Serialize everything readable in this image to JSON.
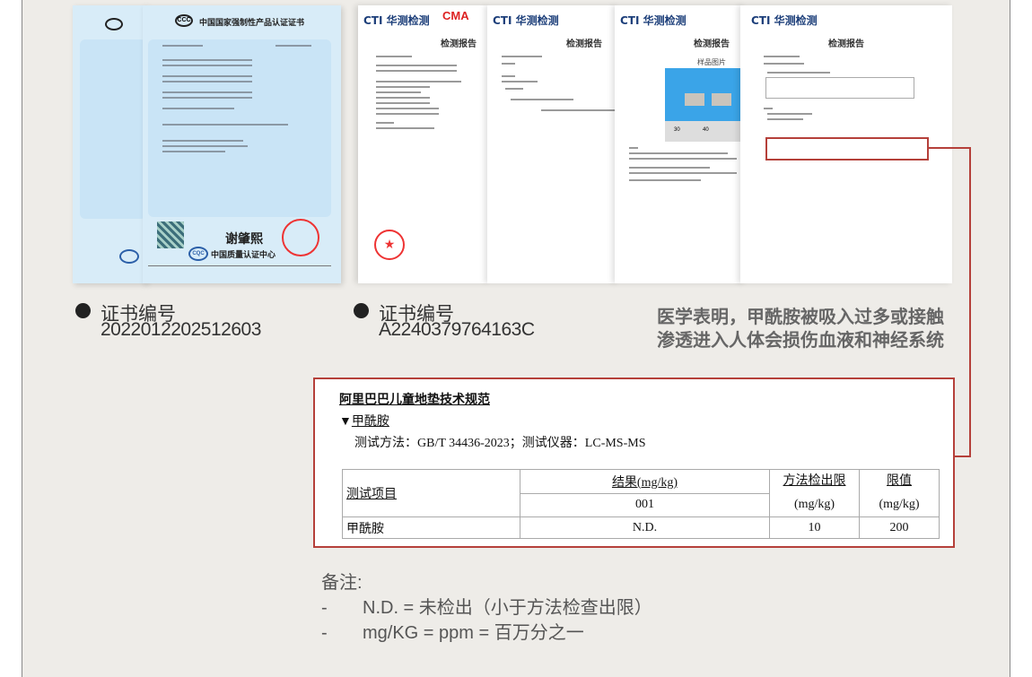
{
  "certificates": {
    "ccc": {
      "title": "中国国家强制性产品认证证书",
      "issuer": "中国质量认证中心",
      "logo": "CCC",
      "issuer_logo": "CQC",
      "signature": "谢肇熙"
    },
    "reports": [
      {
        "brand": "CTI 华测检测",
        "title": "检测报告",
        "mark": "CMA"
      },
      {
        "brand": "CTI 华测检测",
        "title": "检测报告"
      },
      {
        "brand": "CTI 华测检测",
        "title": "检测报告",
        "sample_label": "样品图片",
        "ruler": [
          "30",
          "40"
        ]
      },
      {
        "brand": "CTI 华测检测",
        "title": "检测报告"
      }
    ]
  },
  "captions": [
    {
      "label": "证书编号",
      "number": "2022012202512603"
    },
    {
      "label": "证书编号",
      "number": "A2240379764163C"
    }
  ],
  "warning": {
    "line1": "医学表明，甲酰胺被吸入过多或接触",
    "line2": "渗透进入人体会损伤血液和神经系统"
  },
  "highlight": {
    "heading": "阿里巴巴儿童地垫技术规范",
    "substance_marker": "▼",
    "substance": "甲酰胺",
    "method": "测试方法：GB/T 34436-2023；测试仪器：LC-MS-MS",
    "table": {
      "col_item": "测试项目",
      "col_result": "结果(mg/kg)",
      "sample_id": "001",
      "col_mdl": "方法检出限",
      "col_mdl_unit": "(mg/kg)",
      "col_limit": "限值",
      "col_limit_unit": "(mg/kg)",
      "rows": [
        {
          "item": "甲酰胺",
          "result": "N.D.",
          "mdl": "10",
          "limit": "200"
        }
      ]
    }
  },
  "notes": {
    "title": "备注:",
    "items": [
      "N.D. = 未检出（小于方法检查出限）",
      "mg/KG = ppm = 百万分之一"
    ],
    "bullet": "-"
  },
  "colors": {
    "accent_red": "#b5403a",
    "background": "#eeece8",
    "cert_blue": "#d8ecf8",
    "brand_blue": "#1d3f7a"
  }
}
